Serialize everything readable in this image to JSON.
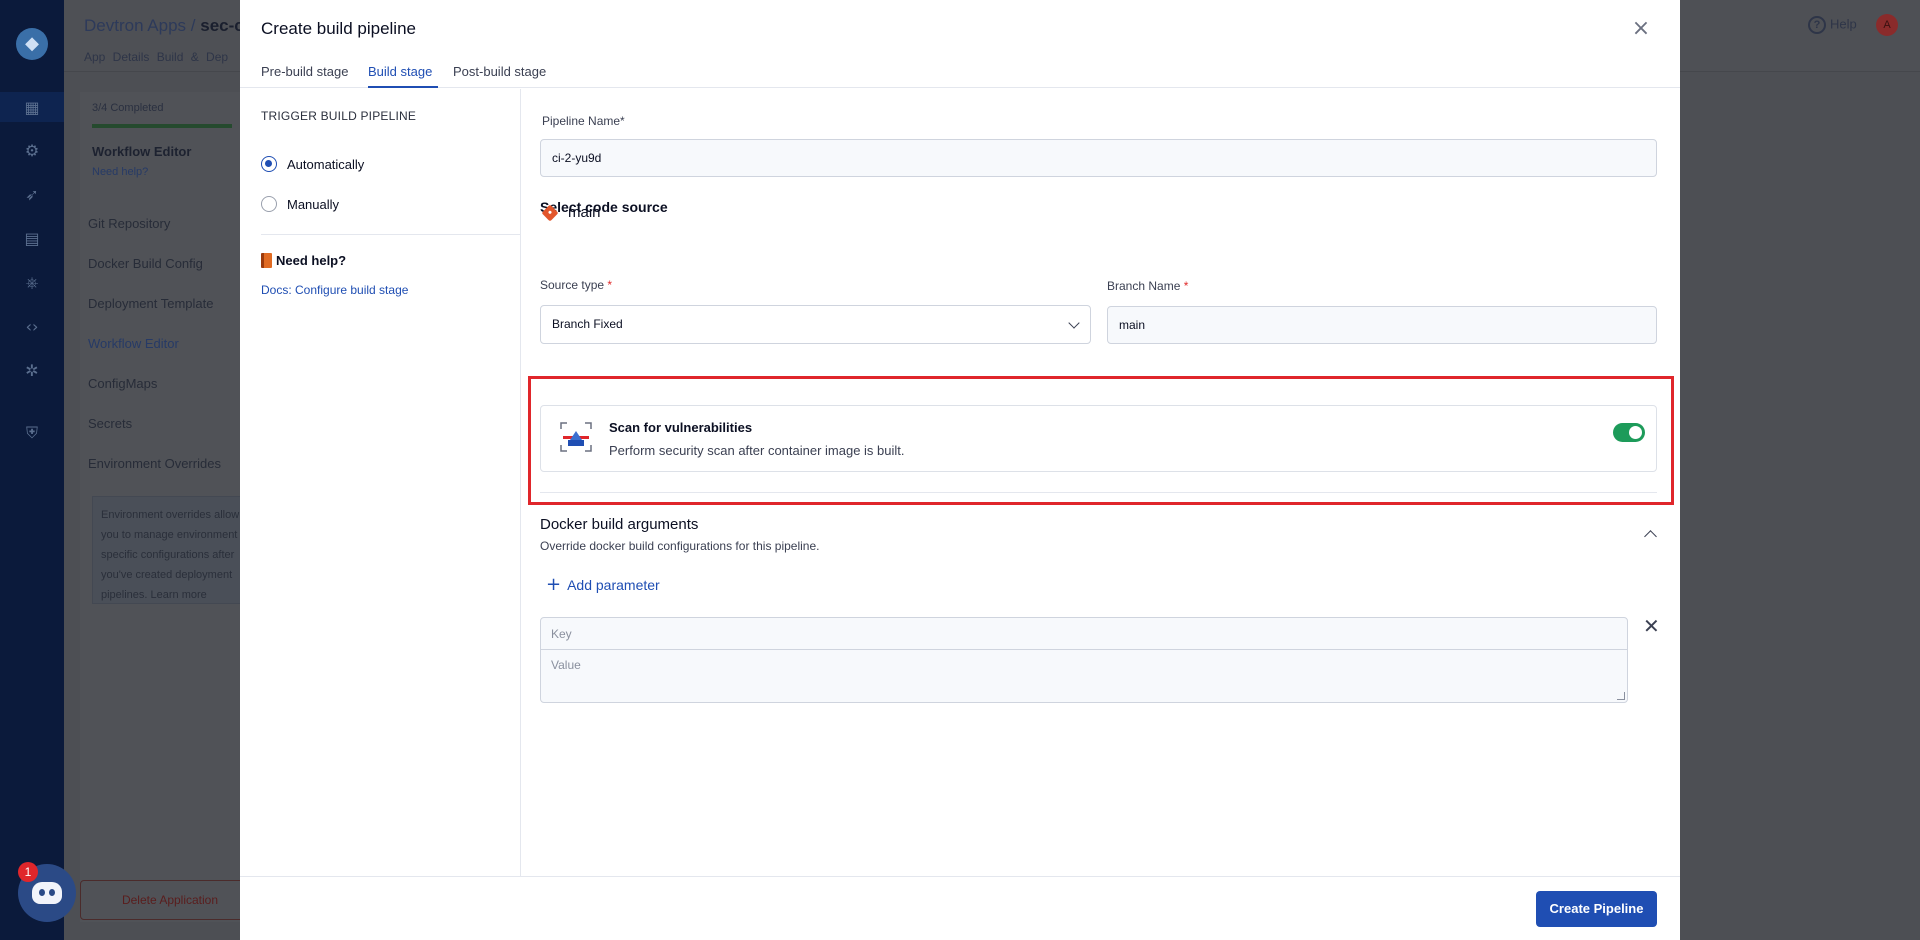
{
  "background_app": {
    "breadcrumb_root": "Devtron Apps /",
    "breadcrumb_app": "sec-c",
    "tabs_text": "App Details   Build & Dep",
    "help_label": "Help",
    "avatar_initial": "A",
    "progress_label": "3/4 Completed",
    "workflow_editor_heading": "Workflow Editor",
    "need_help_link": "Need help?",
    "nav_items": [
      "Git Repository",
      "Docker Build Config",
      "Deployment Template",
      "Workflow Editor",
      "ConfigMaps",
      "Secrets",
      "Environment Overrides"
    ],
    "env_note": "Environment overrides allow you to manage environment specific configurations after you've created deployment pipelines.  Learn more",
    "delete_label": "Delete Application",
    "discord_badge": "1"
  },
  "modal": {
    "title": "Create build pipeline",
    "close_icon": "close-icon",
    "tabs": [
      {
        "label": "Pre-build stage"
      },
      {
        "label": "Build stage",
        "active": true
      },
      {
        "label": "Post-build stage"
      }
    ],
    "sidebar": {
      "trigger_heading": "TRIGGER BUILD PIPELINE",
      "options": [
        {
          "label": "Automatically",
          "checked": true
        },
        {
          "label": "Manually",
          "checked": false
        }
      ],
      "need_help": "Need help?",
      "docs_link": "Docs: Configure build stage"
    },
    "form": {
      "pipeline_name_label": "Pipeline Name*",
      "pipeline_name_value": "ci-2-yu9d",
      "code_source_heading": "Select code source",
      "repo_name": "main",
      "source_type_label": "Source type",
      "source_type_value": "Branch Fixed",
      "branch_name_label": "Branch Name",
      "branch_name_value": "main",
      "required_mark": "*"
    },
    "scan": {
      "title": "Scan for vulnerabilities",
      "description": "Perform security scan after container image is built.",
      "enabled": true
    },
    "docker_args": {
      "title": "Docker build arguments",
      "subtitle": "Override docker build configurations for this pipeline.",
      "add_parameter": "Add parameter",
      "key_placeholder": "Key",
      "value_placeholder": "Value"
    },
    "footer": {
      "create_button": "Create Pipeline"
    }
  },
  "colors": {
    "primary": "#1f4eb3",
    "toggle_on": "#1d9b5a",
    "highlight_border": "#e0262b",
    "required": "#e02a2a"
  }
}
